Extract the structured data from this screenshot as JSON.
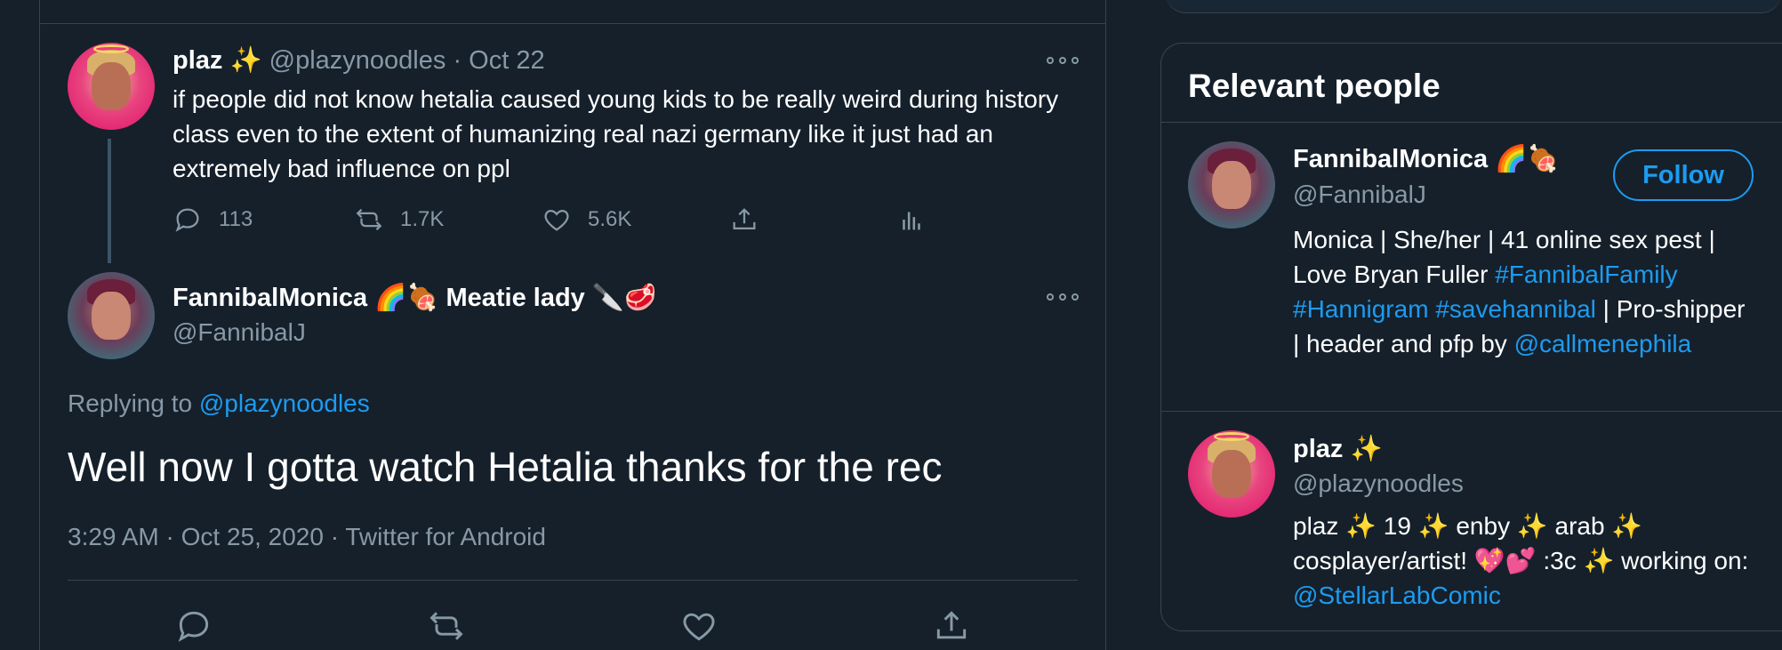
{
  "tweet1": {
    "name": "plaz ✨",
    "handle": "@plazynoodles",
    "separator": "·",
    "date": "Oct 22",
    "text": "if people did not know hetalia caused young kids to be really weird during history class even to the extent of humanizing real nazi germany like it just had an extremely bad influence on ppl",
    "reply_count": "113",
    "retweet_count": "1.7K",
    "like_count": "5.6K"
  },
  "tweet2": {
    "name": "FannibalMonica 🌈🍖 Meatie lady 🔪🥩",
    "handle": "@FannibalJ",
    "replying_prefix": "Replying to ",
    "replying_to": "@plazynoodles",
    "text": "Well now I gotta watch Hetalia thanks for the rec",
    "meta": "3:29 AM · Oct 25, 2020 · Twitter for Android"
  },
  "sidebar": {
    "title": "Relevant people",
    "people": [
      {
        "name": "FannibalMonica 🌈🍖",
        "handle": "@FannibalJ",
        "follow_label": "Follow",
        "bio_text": "Monica | She/her | 41 online sex pest | Love Bryan Fuller",
        "bio_tag1": "#FannibalFamily",
        "bio_tag2": "#Hannigram",
        "bio_tag3": "#savehannibal",
        "bio_mid": " | Pro-shipper | header and pfp by ",
        "bio_link": "@callmenephila"
      },
      {
        "name": "plaz ✨",
        "handle": "@plazynoodles",
        "bio_text": "plaz ✨ 19 ✨ enby ✨ arab ✨ cosplayer/artist! 💖💕 :3c ✨ working on: ",
        "bio_link": "@StellarLabComic"
      }
    ]
  },
  "colors": {
    "background": "#15202b",
    "accent": "#1d9bf0",
    "muted": "#8899a6",
    "border": "#38444d"
  },
  "icons": [
    "reply-icon",
    "retweet-icon",
    "like-icon",
    "share-icon",
    "analytics-icon",
    "more-icon"
  ]
}
